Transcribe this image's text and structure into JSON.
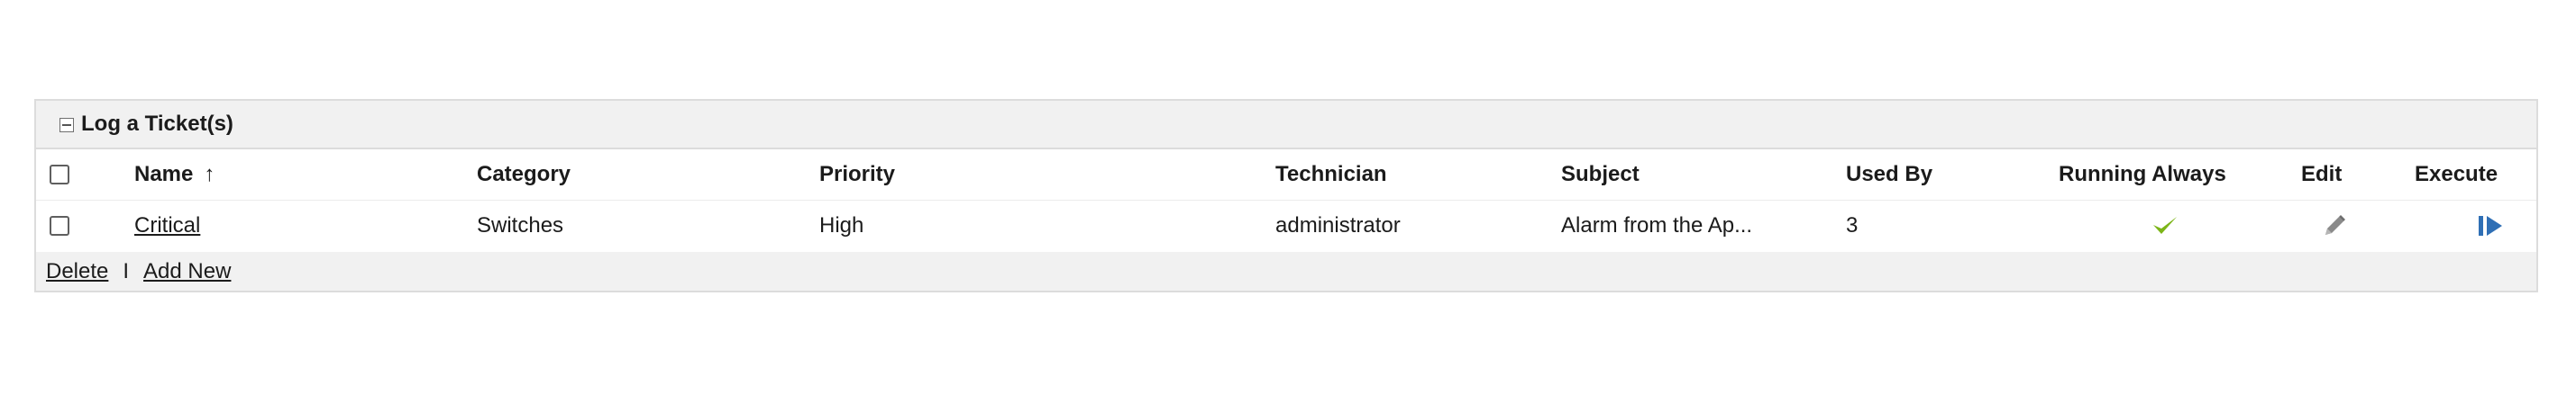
{
  "panel": {
    "title": "Log a Ticket(s)"
  },
  "table": {
    "columns": {
      "name": "Name",
      "category": "Category",
      "priority": "Priority",
      "technician": "Technician",
      "subject": "Subject",
      "used_by": "Used By",
      "running_always": "Running Always",
      "edit": "Edit",
      "execute": "Execute"
    },
    "sort": {
      "column": "Name",
      "direction": "ascending",
      "icon": "sort-up-arrow-icon",
      "glyph": "↑"
    },
    "rows": [
      {
        "name": "Critical",
        "category": "Switches",
        "priority": "High",
        "technician": "administrator",
        "subject": "Alarm from the Ap...",
        "used_by": "3",
        "running_always_icon": "checkmark-icon",
        "edit_icon": "pencil-icon",
        "execute_icon": "execute-icon"
      }
    ]
  },
  "footer": {
    "delete_label": "Delete",
    "separator": "I",
    "add_new_label": "Add New"
  },
  "colors": {
    "header_bg": "#f1f1f1",
    "border": "#dcdcdc",
    "check_green": "#7cb518",
    "pencil_gray": "#8a8a8a",
    "execute_blue": "#2f6fb5"
  }
}
